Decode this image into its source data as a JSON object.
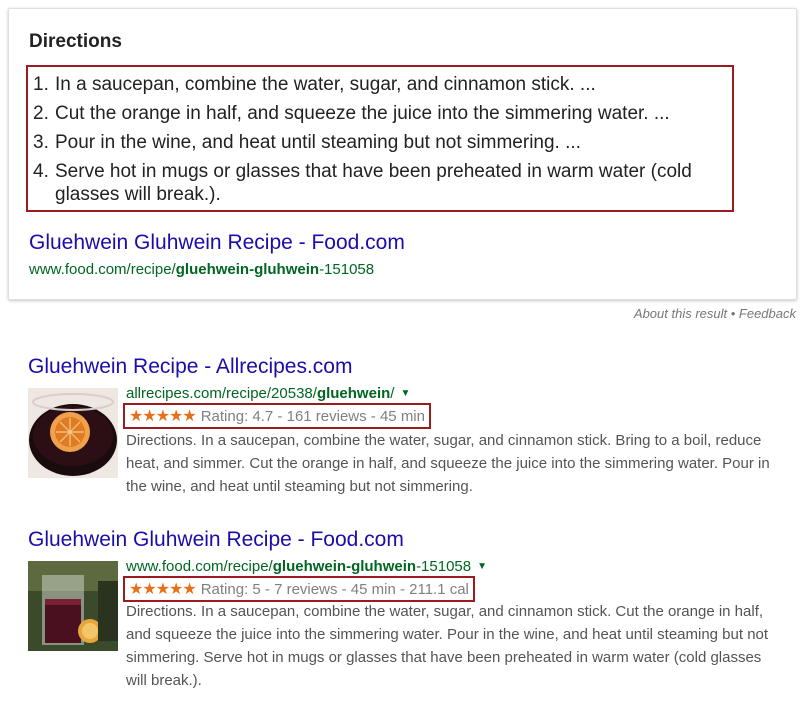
{
  "featured": {
    "heading": "Directions",
    "steps": [
      {
        "num": "1.",
        "text": "In a saucepan, combine the water, sugar, and cinnamon stick. ..."
      },
      {
        "num": "2.",
        "text": "Cut the orange in half, and squeeze the juice into the simmering water. ..."
      },
      {
        "num": "3.",
        "text": "Pour in the wine, and heat until steaming but not simmering. ..."
      },
      {
        "num": "4.",
        "text": "Serve hot in mugs or glasses that have been preheated in warm water (cold glasses will break.)."
      }
    ],
    "link_title": "Gluehwein Gluhwein Recipe - Food.com",
    "url_prefix": "www.food.com/recipe/",
    "url_bold": "gluehwein-gluhwein",
    "url_suffix": "-151058"
  },
  "feedback": {
    "about": "About this result",
    "separator": " • ",
    "feedback": "Feedback"
  },
  "results": [
    {
      "title": "Gluehwein Recipe - Allrecipes.com",
      "url_prefix": "allrecipes.com/recipe/20538/",
      "url_bold": "gluehwein",
      "url_suffix": "/",
      "stars": "★★★★★",
      "rating": 4.7,
      "rating_text": "Rating: 4.7 - 161 reviews - 45 min",
      "snippet": "Directions. In a saucepan, combine the water, sugar, and cinnamon stick. Bring to a boil, reduce heat, and simmer. Cut the orange in half, and squeeze the juice into the simmering water. Pour in the wine, and heat until steaming but not simmering."
    },
    {
      "title": "Gluehwein Gluhwein Recipe - Food.com",
      "url_prefix": "www.food.com/recipe/",
      "url_bold": "gluehwein-gluhwein",
      "url_suffix": "-151058",
      "stars": "★★★★★",
      "rating": 5,
      "rating_text": "Rating: 5 - 7 reviews - 45 min - 211.1 cal",
      "snippet": "Directions. In a saucepan, combine the water, sugar, and cinnamon stick. Cut the orange in half, and squeeze the juice into the simmering water. Pour in the wine, and heat until steaming but not simmering. Serve hot in mugs or glasses that have been preheated in warm water (cold glasses will break.)."
    }
  ],
  "colors": {
    "link": "#1a0dab",
    "url": "#006621",
    "highlight_border": "#9b1c1f",
    "stars": "#e7711b"
  }
}
